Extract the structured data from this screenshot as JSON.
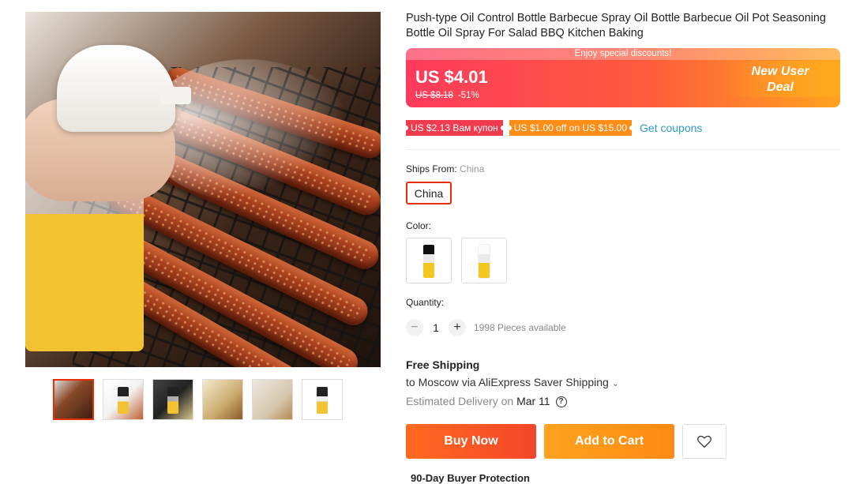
{
  "product": {
    "title": "Push-type Oil Control Bottle Barbecue Spray Oil Bottle Barbecue Oil Pot Seasoning Bottle Oil Spray For Salad BBQ Kitchen Baking"
  },
  "gallery": {
    "thumbnail_count": 6,
    "active_index": 0
  },
  "price": {
    "banner_text": "Enjoy special discounts!",
    "current": "US $4.01",
    "original": "US $8.18",
    "discount": "-51%",
    "deal_line1": "New User",
    "deal_line2": "Deal",
    "colors": {
      "start": "#fd3a5c",
      "end": "#ffa21f"
    }
  },
  "coupons": [
    {
      "text": "US $2.13 Вам купон",
      "color": "#f03a4e"
    },
    {
      "text": "US $1.00 off on US $15.00",
      "color": "#fc8e18"
    }
  ],
  "get_coupons_label": "Get coupons",
  "ships_from": {
    "label": "Ships From:",
    "value": "China",
    "option": "China"
  },
  "color": {
    "label": "Color:",
    "options": [
      "black-cap-bottle",
      "white-cap-bottle"
    ]
  },
  "quantity": {
    "label": "Quantity:",
    "minus": "−",
    "value": "1",
    "plus": "+",
    "available": "1998 Pieces available"
  },
  "shipping": {
    "title": "Free Shipping",
    "to": "to Moscow via AliExpress Saver Shipping",
    "chevron": "⌄",
    "delivery_prefix": "Estimated Delivery on",
    "delivery_date": "Mar 11",
    "help": "?"
  },
  "actions": {
    "buy_now": "Buy Now",
    "add_to_cart": "Add to Cart",
    "wishlist_icon": "heart-icon"
  },
  "protection": "90-Day Buyer Protection",
  "accent": "#e62e04"
}
